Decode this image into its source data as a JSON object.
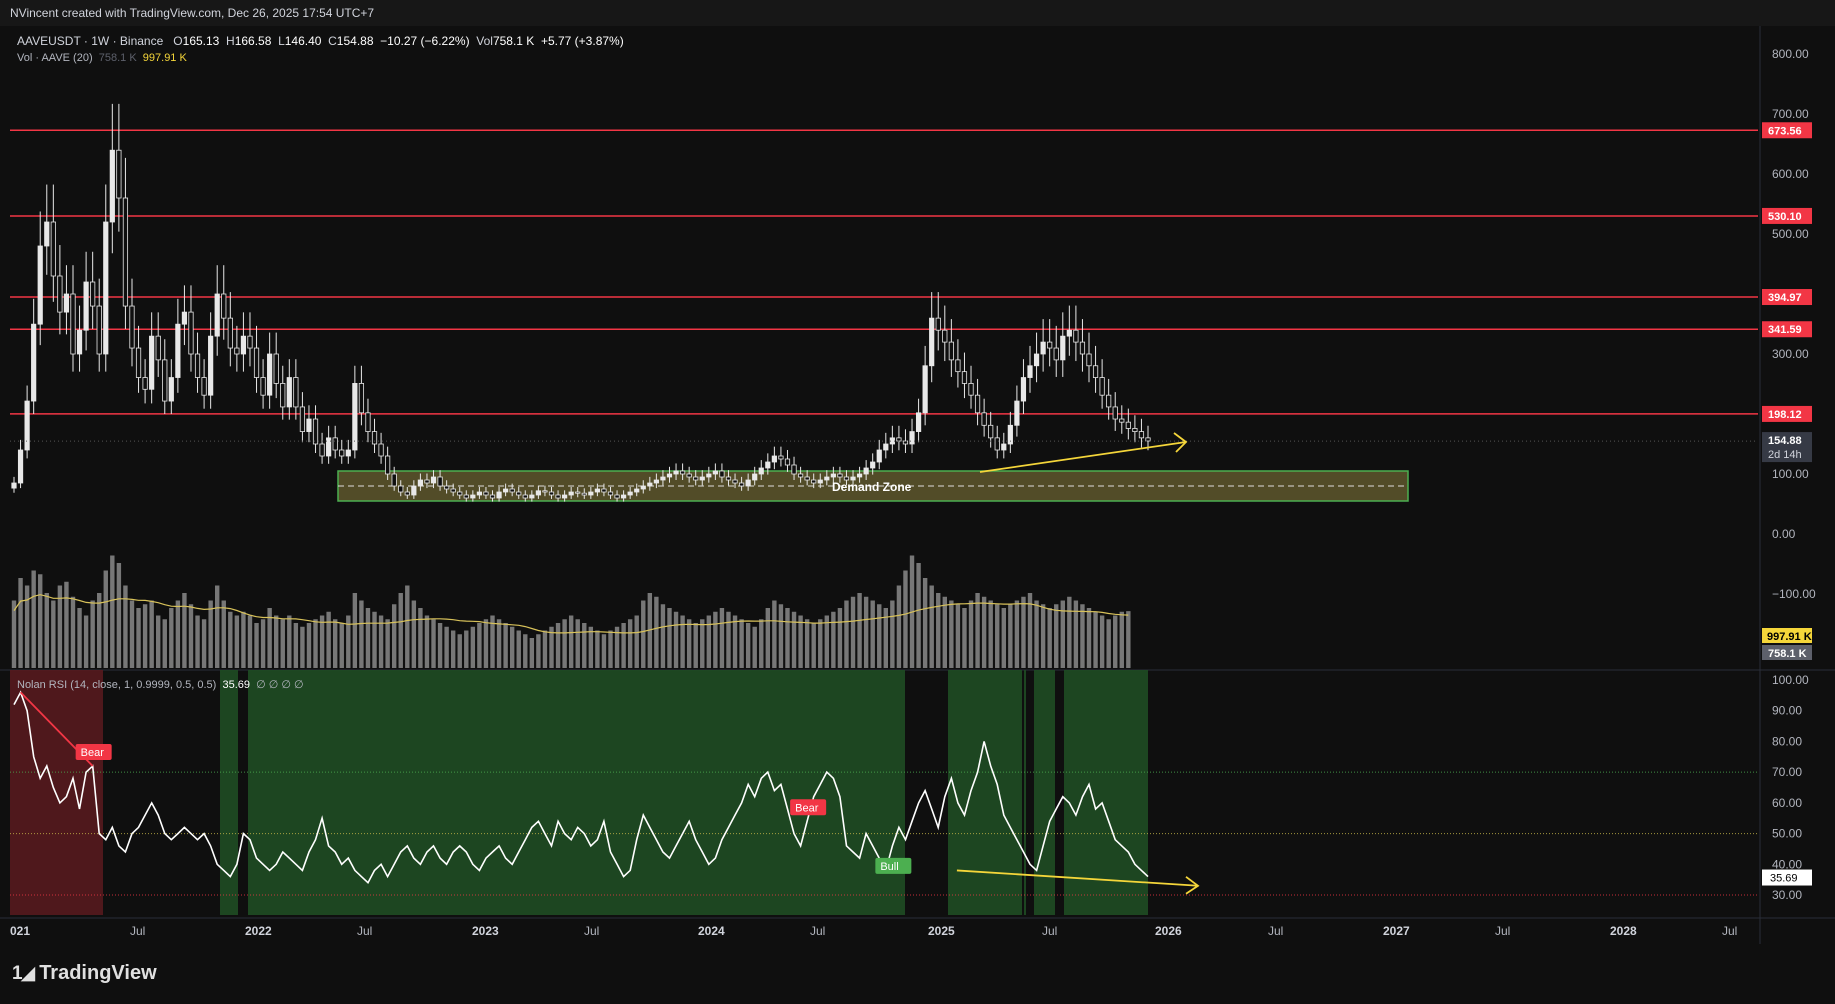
{
  "header": {
    "attribution": "NVincent created with TradingView.com, Dec 26, 2025 17:54 UTC+7"
  },
  "legend": {
    "symbol": "AAVEUSDT · 1W · Binance",
    "open_label": "O",
    "open": "165.13",
    "high_label": "H",
    "high": "166.58",
    "low_label": "L",
    "low": "146.40",
    "close_label": "C",
    "close": "154.88",
    "change": "−10.27 (−6.22%)",
    "vol_label": "Vol",
    "vol": "758.1 K",
    "vol_change": "+5.77 (+3.87%)",
    "volume_indicator": "Vol · AAVE (20)",
    "volume_value": "758.1 K",
    "volume_ma_value": "997.91 K",
    "rsi_indicator": "Nolan RSI (14, close, 1, 0.9999, 0.5, 0.5)",
    "rsi_value": "35.69",
    "rsi_extra": "∅ ∅ ∅ ∅"
  },
  "branding": {
    "logo_text": "TradingView"
  },
  "chart_data": [
    {
      "type": "candlestick",
      "title": "AAVEUSDT · 1W · Binance",
      "price_axis_ticks": [
        800,
        700,
        600,
        500,
        300,
        100,
        0,
        -100
      ],
      "price_axis_labels": [
        "800.00",
        "700.00",
        "600.00",
        "500.00",
        "300.00",
        "100.00",
        "0.00",
        "−100.00"
      ],
      "horizontal_levels": [
        {
          "value": 673.56,
          "label": "673.56",
          "color": "#f23645"
        },
        {
          "value": 530.1,
          "label": "530.10",
          "color": "#f23645"
        },
        {
          "value": 394.97,
          "label": "394.97",
          "color": "#f23645"
        },
        {
          "value": 341.59,
          "label": "341.59",
          "color": "#f23645"
        },
        {
          "value": 198.12,
          "label": "198.12",
          "color": "#f23645"
        }
      ],
      "last_price": {
        "value": 154.88,
        "label": "154.88",
        "countdown": "2d 14h"
      },
      "demand_zone": {
        "label": "Demand Zone",
        "from": "2021-06",
        "to": "2026-05",
        "price_low": 55,
        "price_high": 105,
        "color": "#4caf50"
      },
      "trend_arrow": {
        "from": "2025-04",
        "to": "2026-03",
        "price_from": 120,
        "price_to": 150,
        "color": "#f5d63a"
      },
      "x_axis_labels": [
        "021",
        "Jul",
        "2022",
        "Jul",
        "2023",
        "Jul",
        "2024",
        "Jul",
        "2025",
        "Jul",
        "2026",
        "Jul",
        "2027",
        "Jul",
        "2028",
        "Jul"
      ],
      "weekly_closes": [
        85,
        140,
        220,
        350,
        480,
        520,
        430,
        370,
        400,
        300,
        340,
        420,
        380,
        300,
        520,
        640,
        560,
        380,
        310,
        260,
        240,
        330,
        290,
        220,
        260,
        350,
        370,
        300,
        260,
        230,
        330,
        400,
        360,
        310,
        300,
        330,
        310,
        260,
        230,
        300,
        250,
        210,
        260,
        210,
        170,
        190,
        150,
        130,
        160,
        140,
        130,
        140,
        250,
        200,
        170,
        150,
        130,
        100,
        80,
        70,
        65,
        80,
        90,
        85,
        95,
        80,
        75,
        70,
        65,
        60,
        65,
        70,
        65,
        60,
        70,
        75,
        70,
        65,
        60,
        65,
        72,
        70,
        65,
        60,
        65,
        70,
        68,
        65,
        70,
        75,
        70,
        65,
        60,
        65,
        70,
        75,
        80,
        85,
        90,
        95,
        100,
        105,
        100,
        95,
        90,
        95,
        100,
        105,
        95,
        90,
        85,
        80,
        90,
        100,
        110,
        120,
        130,
        125,
        115,
        100,
        95,
        90,
        85,
        90,
        95,
        100,
        95,
        90,
        95,
        100,
        110,
        120,
        140,
        150,
        160,
        155,
        150,
        170,
        200,
        280,
        360,
        340,
        320,
        290,
        270,
        250,
        230,
        200,
        180,
        160,
        140,
        150,
        180,
        220,
        260,
        280,
        300,
        320,
        310,
        290,
        330,
        340,
        320,
        300,
        280,
        260,
        230,
        210,
        190,
        185,
        175,
        170,
        160,
        155
      ],
      "weekly_volume_k": [
        900,
        1200,
        1100,
        1300,
        1250,
        1000,
        900,
        1100,
        1150,
        950,
        800,
        700,
        900,
        1000,
        1300,
        1500,
        1400,
        1100,
        900,
        800,
        850,
        900,
        700,
        650,
        800,
        900,
        1000,
        850,
        700,
        650,
        900,
        1100,
        900,
        750,
        700,
        750,
        700,
        600,
        650,
        800,
        700,
        650,
        700,
        600,
        550,
        600,
        650,
        700,
        750,
        650,
        600,
        700,
        1000,
        900,
        800,
        750,
        700,
        650,
        850,
        1000,
        1100,
        900,
        800,
        700,
        650,
        600,
        550,
        500,
        450,
        500,
        550,
        600,
        650,
        700,
        650,
        600,
        550,
        500,
        450,
        400,
        450,
        500,
        550,
        600,
        650,
        700,
        650,
        600,
        550,
        500,
        450,
        500,
        550,
        600,
        650,
        700,
        900,
        1000,
        950,
        850,
        800,
        750,
        700,
        650,
        600,
        650,
        700,
        750,
        800,
        750,
        700,
        650,
        600,
        550,
        650,
        800,
        900,
        850,
        800,
        750,
        700,
        650,
        600,
        650,
        700,
        750,
        800,
        900,
        950,
        1000,
        950,
        900,
        850,
        800,
        900,
        1100,
        1300,
        1500,
        1400,
        1200,
        1100,
        1000,
        950,
        900,
        850,
        800,
        900,
        1000,
        950,
        900,
        850,
        800,
        850,
        900,
        950,
        1000,
        900,
        850,
        800,
        850,
        900,
        950,
        900,
        850,
        800,
        750,
        700,
        650,
        700,
        750,
        758
      ]
    },
    {
      "type": "line",
      "title": "Nolan RSI (14, close, 1, 0.9999, 0.5, 0.5)",
      "y_axis_labels": [
        "100.00",
        "90.00",
        "80.00",
        "70.00",
        "60.00",
        "50.00",
        "40.00",
        "30.00"
      ],
      "ylim": [
        25,
        100
      ],
      "reference_lines": [
        70,
        50,
        30
      ],
      "current_value": 35.69,
      "values": [
        92,
        96,
        90,
        75,
        68,
        72,
        65,
        60,
        62,
        68,
        58,
        70,
        72,
        50,
        48,
        52,
        46,
        44,
        50,
        52,
        56,
        60,
        56,
        50,
        48,
        50,
        52,
        50,
        48,
        50,
        46,
        40,
        38,
        36,
        40,
        50,
        48,
        42,
        40,
        38,
        40,
        44,
        42,
        40,
        38,
        44,
        48,
        55,
        46,
        44,
        40,
        42,
        38,
        36,
        34,
        38,
        40,
        36,
        40,
        44,
        46,
        42,
        40,
        44,
        46,
        42,
        40,
        44,
        46,
        44,
        40,
        38,
        42,
        44,
        46,
        42,
        40,
        44,
        48,
        52,
        54,
        50,
        46,
        54,
        50,
        48,
        52,
        50,
        46,
        48,
        54,
        44,
        40,
        36,
        38,
        48,
        56,
        52,
        48,
        44,
        42,
        46,
        50,
        54,
        48,
        44,
        40,
        42,
        48,
        52,
        56,
        60,
        66,
        62,
        68,
        70,
        64,
        66,
        58,
        50,
        46,
        54,
        62,
        66,
        70,
        68,
        62,
        46,
        44,
        42,
        50,
        46,
        42,
        38,
        46,
        52,
        48,
        54,
        60,
        64,
        58,
        52,
        62,
        68,
        60,
        56,
        64,
        70,
        80,
        72,
        66,
        56,
        52,
        48,
        44,
        40,
        38,
        46,
        54,
        58,
        62,
        60,
        56,
        62,
        66,
        58,
        60,
        54,
        48,
        46,
        44,
        40,
        38,
        36
      ],
      "signals": [
        {
          "label": "Bear",
          "color": "#f23645",
          "index": 12
        },
        {
          "label": "Bear",
          "color": "#f23645",
          "index": 121
        },
        {
          "label": "Bull",
          "color": "#4caf50",
          "index": 134
        }
      ],
      "trend_arrow": {
        "from_index": 153,
        "to_index": 180,
        "value_from": 38,
        "value_to": 33,
        "color": "#f5d63a"
      }
    }
  ],
  "colors": {
    "bg": "#0f0f0f",
    "level": "#f23645",
    "demand_zone": "#4caf50",
    "arrow": "#f5d63a",
    "candle": "#e8e8e8",
    "volume": "#8a8a8a",
    "volume_ma": "#d8c25a",
    "rsi_line": "#ffffff",
    "rsi_bull_bg": "#1f4d24",
    "rsi_bear_bg": "#5a1a1e"
  }
}
